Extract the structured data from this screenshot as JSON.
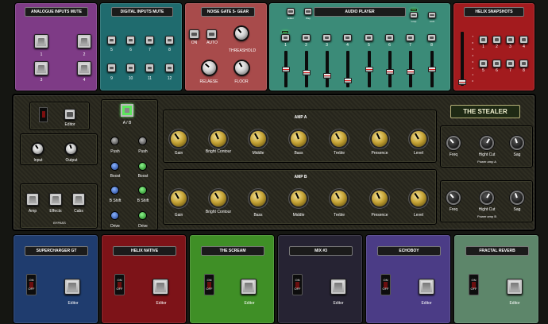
{
  "analogue": {
    "title": "ANALOGUE INPUTS MUTE",
    "buttons": [
      "1",
      "2",
      "3",
      "4"
    ]
  },
  "digital": {
    "title": "DIGITAL INPUTS MUTE",
    "buttons": [
      "5",
      "6",
      "7",
      "8",
      "9",
      "10",
      "11",
      "12"
    ]
  },
  "noise_gate": {
    "title": "NOISE GATE 5- GEAR",
    "on": "ON",
    "auto": "AUTO",
    "threshold": "THREASHOLD",
    "release": "RELAESE",
    "floor": "FLOOR"
  },
  "audio_player": {
    "title": "AUDIO PLAYER",
    "buttons": [
      "Editor",
      "Play",
      "",
      "",
      "",
      "",
      "",
      "Loop",
      "Lock"
    ],
    "channels": [
      "1",
      "2",
      "3",
      "4",
      "5",
      "6",
      "7",
      "8"
    ],
    "fader_levels": [
      0.45,
      0.35,
      0.3,
      0.2,
      0.45,
      0.4,
      0.4,
      0.45
    ]
  },
  "helix": {
    "title": "HELIX SNAPSHOTS",
    "buttons": [
      "1",
      "2",
      "3",
      "4",
      "5",
      "6",
      "7",
      "8"
    ],
    "scale": [
      "0",
      "1",
      "2",
      "3",
      "4",
      "5",
      "6",
      "7"
    ]
  },
  "stealer": {
    "title": "THE STEALER",
    "editor": "Editor",
    "input": "Input",
    "output": "Output",
    "fx_buttons": [
      "Amp",
      "Effects",
      "Cabs"
    ],
    "bypass": "BYPASS",
    "ab": "A / B",
    "switch_labels": [
      [
        "Push",
        "Push"
      ],
      [
        "Boost",
        "Boost"
      ],
      [
        "B Shift",
        "B Shift"
      ],
      [
        "Drive",
        "Drive"
      ]
    ],
    "amp_a": {
      "title": "AMP A",
      "knobs": [
        "Gain",
        "Bright Contour",
        "Middle",
        "Bass",
        "Treble",
        "Presence",
        "Level"
      ]
    },
    "amp_b": {
      "title": "AMP B",
      "knobs": [
        "Gain",
        "Bright Contour",
        "Bass",
        "Middle",
        "Treble",
        "Presence",
        "Level"
      ]
    },
    "power_a": {
      "knobs": [
        "Freq",
        "Hight Cut",
        "Sag"
      ],
      "label": "Power amp A"
    },
    "power_b": {
      "knobs": [
        "Freq",
        "Hight Cut",
        "Sag"
      ],
      "label": "Power amp B"
    }
  },
  "plugins": [
    {
      "title": "SUPERCHARGER GT",
      "on": "ON",
      "off": "OFF",
      "editor": "Editor",
      "color": "#1f3c6e"
    },
    {
      "title": "HELIX NATIVE",
      "on": "ON",
      "off": "OFF",
      "editor": "Editor",
      "color": "#7d1318"
    },
    {
      "title": "THE SCREAM",
      "on": "ON",
      "off": "OFF",
      "editor": "Editor",
      "color": "#3f8f26"
    },
    {
      "title": "MIX #3",
      "on": "ON",
      "off": "OFF",
      "editor": "Editor",
      "color": "#262333"
    },
    {
      "title": "ECHOBOY",
      "on": "ON",
      "off": "OFF",
      "editor": "Editor",
      "color": "#4b3c86"
    },
    {
      "title": "FRACTAL REVERB",
      "on": "ON",
      "off": "OFF",
      "editor": "Editor",
      "color": "#5d866a"
    }
  ]
}
